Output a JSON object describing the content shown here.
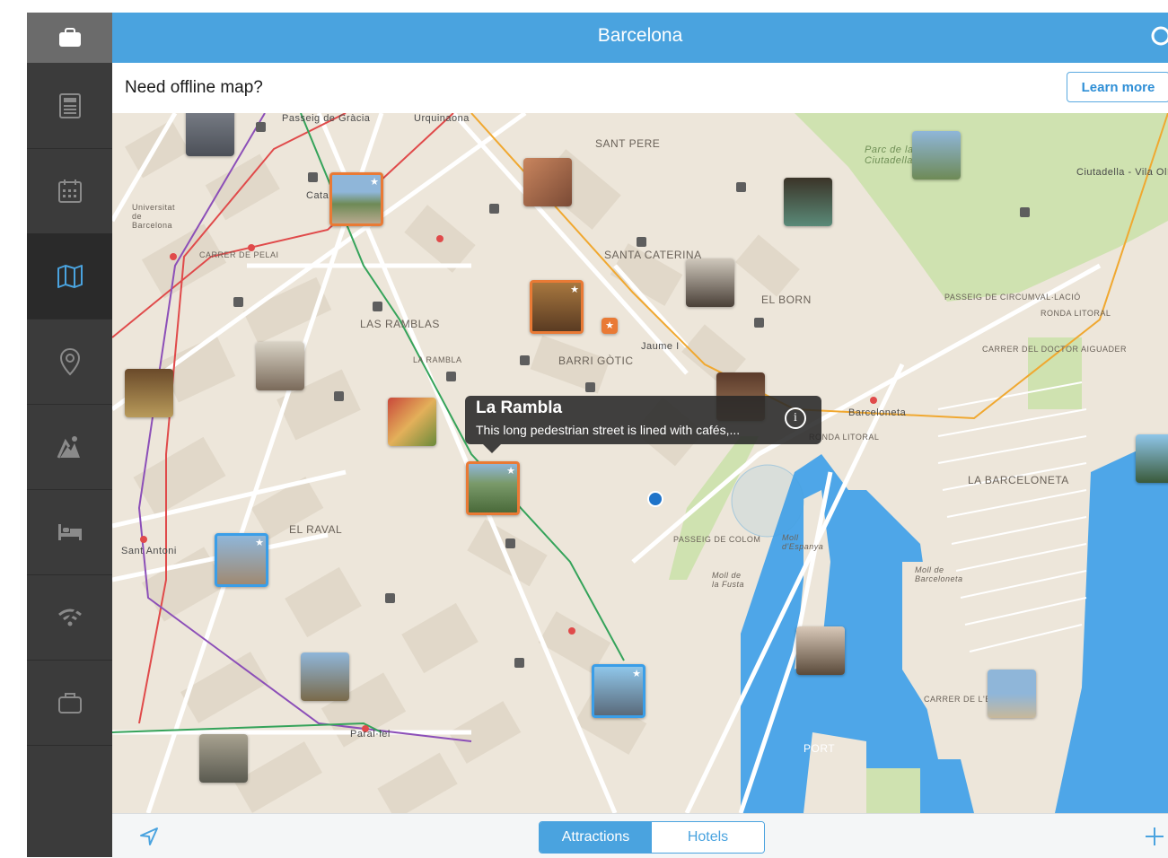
{
  "header": {
    "title": "Barcelona",
    "search_icon": "search-icon"
  },
  "offline_banner": {
    "message": "Need offline map?",
    "button": "Learn more"
  },
  "sidebar": {
    "items": [
      {
        "icon": "suitcase-icon",
        "name": "suitcase"
      },
      {
        "icon": "guide-book-icon",
        "name": "guide"
      },
      {
        "icon": "calendar-icon",
        "name": "calendar"
      },
      {
        "icon": "map-icon",
        "name": "map",
        "active": true
      },
      {
        "icon": "location-pin-icon",
        "name": "places"
      },
      {
        "icon": "hiking-icon",
        "name": "activities"
      },
      {
        "icon": "hotel-bed-icon",
        "name": "hotels"
      },
      {
        "icon": "wifi-icon",
        "name": "wifi"
      },
      {
        "icon": "briefcase-icon",
        "name": "trips"
      }
    ]
  },
  "map": {
    "labels": [
      "SANT PERE",
      "SANTA CATERINA",
      "EL BORN",
      "BARRI GÒTIC",
      "LAS RAMBLAS",
      "EL RAVAL",
      "LA BARCELONETA",
      "PORT",
      "Parc de la Ciutadella",
      "Ciutadella - Vila Olímpica",
      "Barceloneta",
      "Universitat de Barcelona",
      "Catalunya",
      "Jaume I",
      "Sant Antoni",
      "Paral·lel",
      "Urquinaona",
      "Passeig de Gràcia",
      "PASSEIG DE CIRCUMVAL·LACIÓ",
      "RONDA LITORAL",
      "CARRER DEL DOCTOR AIGUADER",
      "RONDA LITORAL",
      "CARRER DE PELAI",
      "LA RAMBLA",
      "CARRER DE L'ESCAR",
      "Moll d'Espanya",
      "Moll de la Fusta",
      "Moll de Barceloneta",
      "PASSEIG DE COLOM"
    ],
    "popup": {
      "title": "La Rambla",
      "description": "This long pedestrian street is lined with cafés,..."
    },
    "colors": {
      "water": "#4ea6e8",
      "park": "#cfe2b0",
      "featured": "#e97a35",
      "selected": "#3a9ee8"
    }
  },
  "bottom": {
    "location_icon": "location-arrow-icon",
    "tabs": [
      {
        "label": "Attractions",
        "active": true
      },
      {
        "label": "Hotels",
        "active": false
      }
    ],
    "add_icon": "plus-icon"
  }
}
